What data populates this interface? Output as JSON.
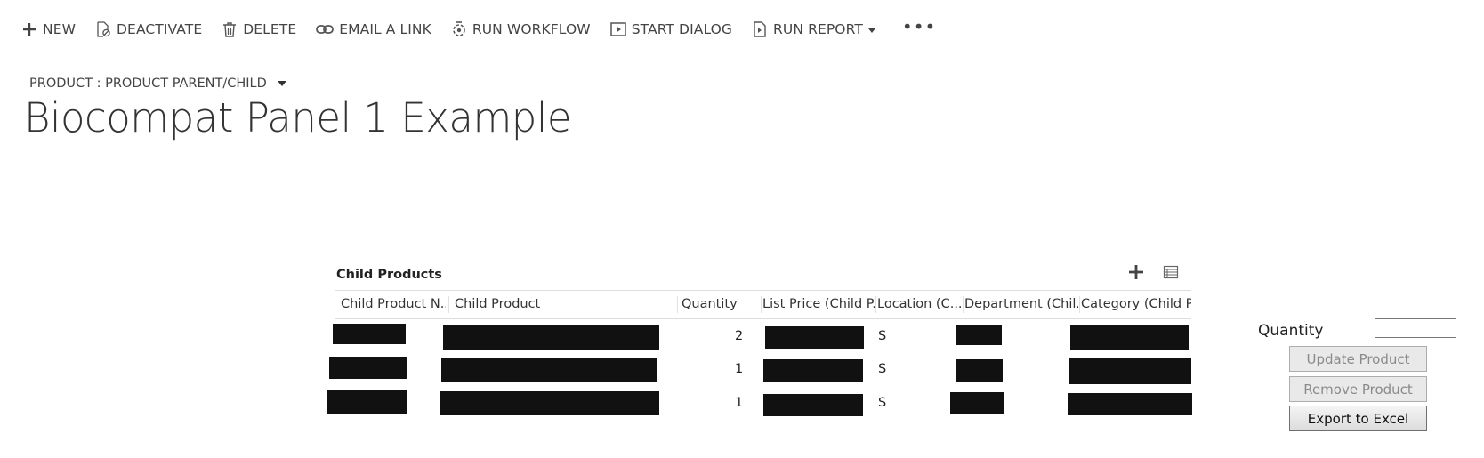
{
  "toolbar": {
    "new_label": "NEW",
    "deactivate_label": "DEACTIVATE",
    "delete_label": "DELETE",
    "email_label": "EMAIL A LINK",
    "workflow_label": "RUN WORKFLOW",
    "dialog_label": "START DIALOG",
    "report_label": "RUN REPORT",
    "more_label": "•••",
    "icons": [
      "plus-icon",
      "deactivate-icon",
      "trash-icon",
      "link-icon",
      "workflow-icon",
      "dialog-icon",
      "report-icon",
      "more-icon"
    ]
  },
  "form": {
    "selector_label": "PRODUCT : PRODUCT PARENT/CHILD",
    "title": "Biocompat Panel 1 Example"
  },
  "grid": {
    "title": "Child Products",
    "columns": [
      "Child Product N...",
      "Child Product",
      "Quantity",
      "List Price (Child P...",
      "Location (C...",
      "Department (Chil...",
      "Category (Child Proc"
    ],
    "rows": [
      {
        "child_product_number": "[redacted]",
        "child_product": "[redacted]",
        "quantity": "2",
        "list_price": "[redacted]",
        "location": "S",
        "department": "[redacted]",
        "category": "[redacted]"
      },
      {
        "child_product_number": "[redacted]",
        "child_product": "[redacted]",
        "quantity": "1",
        "list_price": "[redacted]",
        "location": "S",
        "department": "[redacted]",
        "category": "[redacted]"
      },
      {
        "child_product_number": "[redacted]",
        "child_product": "[redacted]",
        "quantity": "1",
        "list_price": "[redacted]",
        "location": "S",
        "department": "[redacted]",
        "category": "[redacted]"
      }
    ]
  },
  "side_panel": {
    "quantity_label": "Quantity",
    "quantity_value": "",
    "update_label": "Update Product",
    "remove_label": "Remove Product",
    "export_label": "Export to Excel"
  },
  "colors": {
    "redaction": "#111111",
    "text": "#222222",
    "toolbar_text": "#444444"
  }
}
